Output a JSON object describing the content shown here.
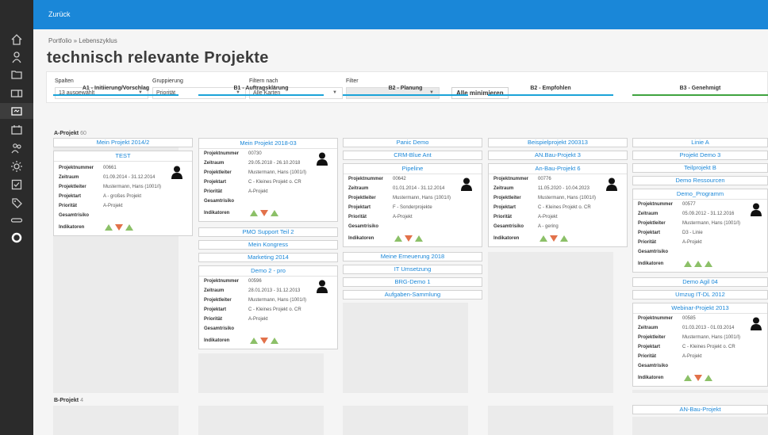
{
  "topbar": {
    "back_label": "Zurück"
  },
  "breadcrumb": "Portfolio » Lebenszyklus",
  "page_title": "technisch relevante Projekte",
  "filters": {
    "columns_label": "Spalten",
    "columns_value": "13 ausgewählt",
    "group_label": "Gruppierung",
    "group_value": "Priorität",
    "filter_by_label": "Filtern nach",
    "filter_by_value": "Alle Karten",
    "filter_label": "Filter",
    "filter_value": "",
    "minimize_label": "Alle minimieren"
  },
  "columns": [
    {
      "title": "A1 - Initiierung/Vorschlag",
      "color": "#1aa3d8"
    },
    {
      "title": "B1 - Auftragsklärung",
      "color": "#1aa3d8"
    },
    {
      "title": "B2 - Planung",
      "color": "#1aa3d8"
    },
    {
      "title": "B2 - Empfohlen",
      "color": "#1aa3d8"
    },
    {
      "title": "B3 - Genehmigt",
      "color": "#3fa33f"
    }
  ],
  "lanes": [
    {
      "name": "A-Projekt",
      "count": "60"
    },
    {
      "name": "B-Projekt",
      "count": "4"
    }
  ],
  "field_labels": {
    "nr": "Projektnummer",
    "time": "Zeitraum",
    "lead": "Projektleiter",
    "type": "Projektart",
    "prio": "Priorität",
    "risk": "Gesamtrisiko",
    "ind": "Indikatoren"
  },
  "col0": {
    "pill": "Mein Projekt 2014/2",
    "card": {
      "title": "TEST",
      "nr": "00661",
      "time": "01.09.2014 - 31.12.2014",
      "lead": "Mustermann, Hans (1001/I)",
      "type": "A - großes Projekt",
      "prio": "A-Projekt",
      "risk": ""
    }
  },
  "col1": {
    "card1": {
      "title": "Mein Projekt 2018-03",
      "nr": "00730",
      "time": "29.05.2018 - 26.10.2018",
      "lead": "Mustermann, Hans (1001/I)",
      "type": "C - Kleines Projekt o. CR",
      "prio": "A-Projekt",
      "risk": ""
    },
    "pills": [
      "PMO Support Teil 2",
      "Mein Kongress",
      "Marketing 2014"
    ],
    "card2": {
      "title": "Demo 2 - pro",
      "nr": "00596",
      "time": "28.01.2013 - 31.12.2013",
      "lead": "Mustermann, Hans (1001/I)",
      "type": "C - Kleines Projekt o. CR",
      "prio": "A-Projekt",
      "risk": ""
    }
  },
  "col2": {
    "pills_top": [
      "Panic Demo",
      "CRM-Blue Ant"
    ],
    "card": {
      "title": "Pipeline",
      "nr": "00642",
      "time": "01.01.2014 - 31.12.2014",
      "lead": "Mustermann, Hans (1001/I)",
      "type": "F - Sonderprojekte",
      "prio": "A-Projekt",
      "risk": ""
    },
    "pills_bottom": [
      "Meine Erneuerung 2018",
      "IT Umsetzung",
      "BRG-Demo 1",
      "Aufgaben-Sammlung"
    ]
  },
  "col3": {
    "pills": [
      "Beispielprojekt 200313",
      "AN.Bau-Projekt 3"
    ],
    "card": {
      "title": "An-Bau-Projekt 6",
      "nr": "00776",
      "time": "11.05.2020 - 10.04.2023",
      "lead": "Mustermann, Hans (1001/I)",
      "type": "C - Kleines Projekt o. CR",
      "prio": "A-Projekt",
      "risk": "A - gering"
    }
  },
  "col4": {
    "pills_top": [
      "Linie A",
      "Projekt Demo 3",
      "Teilprojekt B",
      "Demo Ressourcen"
    ],
    "card1": {
      "title": "Demo_Programm",
      "nr": "00577",
      "time": "05.09.2012 - 31.12.2016",
      "lead": "Mustermann, Hans (1001/I)",
      "type": "D3 - Linie",
      "prio": "A-Projekt",
      "risk": ""
    },
    "pills_mid": [
      "Demo Agil 04",
      "Umzug IT-DL 2012"
    ],
    "card2": {
      "title": "Webinar-Projekt 2013",
      "nr": "00585",
      "time": "01.03.2013 - 01.03.2014",
      "lead": "Mustermann, Hans (1001/I)",
      "type": "C - Kleines Projekt o. CR",
      "prio": "A-Projekt",
      "risk": ""
    },
    "b_pill": "AN-Bau-Projekt"
  },
  "colors": {
    "accent": "#1a87d8",
    "sidebar": "#2b2b2b",
    "up": "#8cc068",
    "down": "#e2714a"
  }
}
